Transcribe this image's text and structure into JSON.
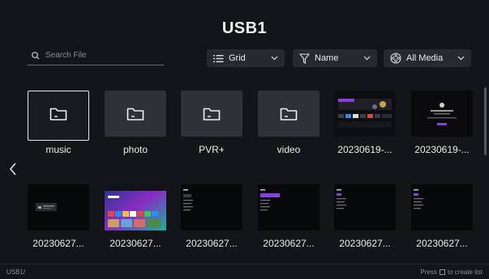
{
  "header": {
    "title": "USB1"
  },
  "search": {
    "placeholder": "Search File"
  },
  "controls": {
    "view": {
      "label": "Grid"
    },
    "sort": {
      "label": "Name"
    },
    "filter": {
      "label": "All Media"
    }
  },
  "folders": [
    {
      "name": "music"
    },
    {
      "name": "photo"
    },
    {
      "name": "PVR+"
    },
    {
      "name": "video"
    }
  ],
  "row1_files": [
    {
      "name": "20230619-..."
    },
    {
      "name": "20230619-..."
    }
  ],
  "row2_files": [
    {
      "name": "20230627..."
    },
    {
      "name": "20230627..."
    },
    {
      "name": "20230627..."
    },
    {
      "name": "20230627..."
    },
    {
      "name": "20230627..."
    },
    {
      "name": "20230627..."
    }
  ],
  "footer": {
    "path": "USB1/",
    "hint_prefix": "Press",
    "hint_suffix": "to create list"
  },
  "colors": {
    "background": "#141519",
    "tile": "#2f3138",
    "accent_purple": "#8a3ee0"
  }
}
